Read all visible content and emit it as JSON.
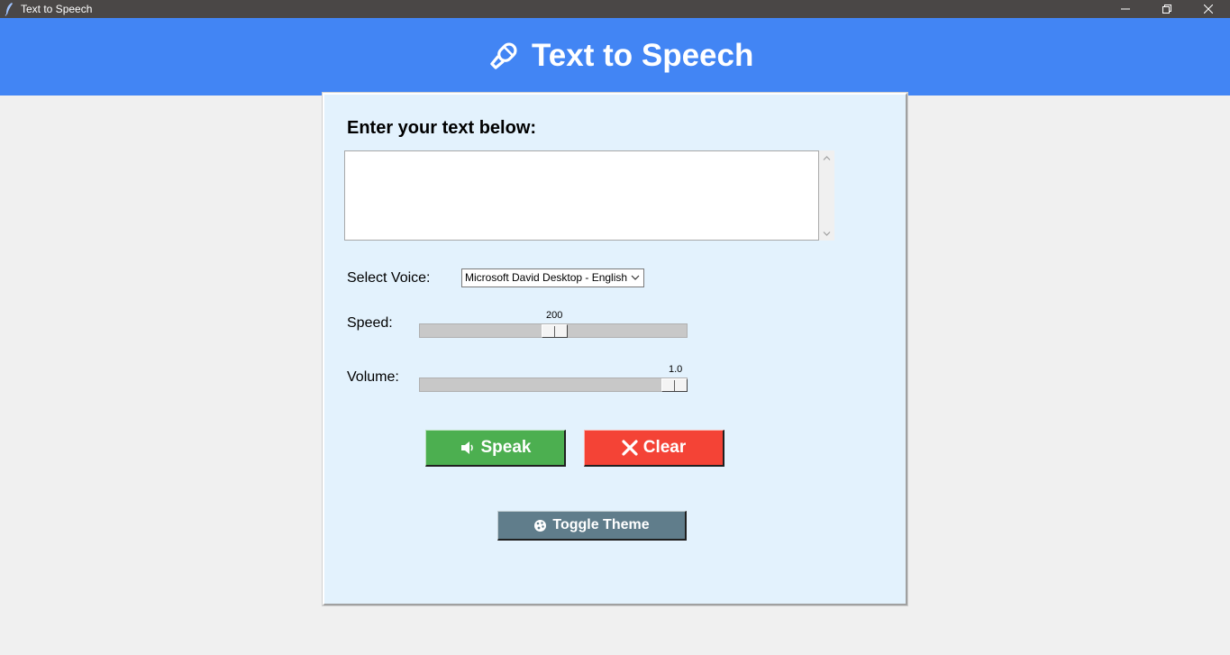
{
  "window": {
    "title": "Text to Speech"
  },
  "header": {
    "title": "Text to Speech",
    "icon": "microphone-icon"
  },
  "form": {
    "prompt_label": "Enter your text below:",
    "text_value": "",
    "voice_label": "Select Voice:",
    "voice_selected": "Microsoft David Desktop - English",
    "speed_label": "Speed:",
    "speed_value": "200",
    "volume_label": "Volume:",
    "volume_value": "1.0"
  },
  "buttons": {
    "speak_label": "Speak",
    "clear_label": "Clear",
    "theme_label": "Toggle Theme"
  },
  "colors": {
    "header": "#4285f4",
    "panel": "#e3f2fd",
    "speak": "#4caf50",
    "clear": "#f44336",
    "theme": "#607d8b"
  }
}
